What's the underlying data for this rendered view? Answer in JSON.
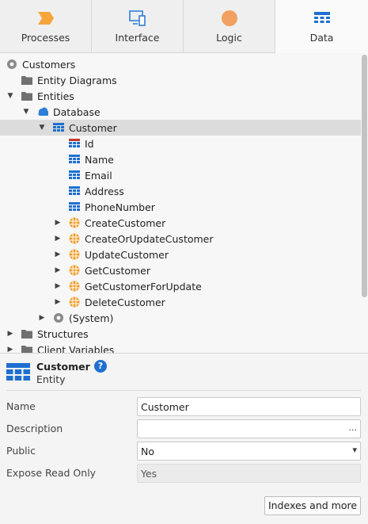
{
  "tabs": [
    {
      "label": "Processes",
      "icon": "processes-icon",
      "color": "#f5a53a"
    },
    {
      "label": "Interface",
      "icon": "interface-icon",
      "color": "#2f7fd9"
    },
    {
      "label": "Logic",
      "icon": "logic-icon",
      "color": "#f0a060"
    },
    {
      "label": "Data",
      "icon": "data-icon",
      "color": "#1e6fd1",
      "active": true
    }
  ],
  "tree": {
    "items": [
      {
        "label": "Customers",
        "icon": "module-icon",
        "arrow": "none"
      },
      {
        "label": "Entity Diagrams",
        "icon": "folder-icon",
        "arrow": "none"
      },
      {
        "label": "Entities",
        "icon": "folder-icon",
        "arrow": "expanded"
      },
      {
        "label": "Database",
        "icon": "database-icon",
        "arrow": "expanded"
      },
      {
        "label": "Customer",
        "icon": "entity-icon",
        "arrow": "expanded",
        "selected": true
      },
      {
        "label": "Id",
        "icon": "identifier-attribute-icon",
        "arrow": "none"
      },
      {
        "label": "Name",
        "icon": "attribute-icon",
        "arrow": "none"
      },
      {
        "label": "Email",
        "icon": "attribute-icon",
        "arrow": "none"
      },
      {
        "label": "Address",
        "icon": "attribute-icon",
        "arrow": "none"
      },
      {
        "label": "PhoneNumber",
        "icon": "attribute-icon",
        "arrow": "none"
      },
      {
        "label": "CreateCustomer",
        "icon": "entity-action-icon",
        "arrow": "collapsed"
      },
      {
        "label": "CreateOrUpdateCustomer",
        "icon": "entity-action-icon",
        "arrow": "collapsed"
      },
      {
        "label": "UpdateCustomer",
        "icon": "entity-action-icon",
        "arrow": "collapsed"
      },
      {
        "label": "GetCustomer",
        "icon": "entity-action-icon",
        "arrow": "collapsed"
      },
      {
        "label": "GetCustomerForUpdate",
        "icon": "entity-action-icon",
        "arrow": "collapsed"
      },
      {
        "label": "DeleteCustomer",
        "icon": "entity-action-icon",
        "arrow": "collapsed"
      },
      {
        "label": "(System)",
        "icon": "system-module-icon",
        "arrow": "collapsed"
      },
      {
        "label": "Structures",
        "icon": "folder-icon",
        "arrow": "collapsed"
      },
      {
        "label": "Client Variables",
        "icon": "folder-icon",
        "arrow": "collapsed"
      }
    ]
  },
  "props": {
    "title": "Customer",
    "subtitle": "Entity",
    "help": "?",
    "fields": [
      {
        "label": "Name",
        "value": "Customer"
      },
      {
        "label": "Description",
        "value": "",
        "trail": "..."
      },
      {
        "label": "Public",
        "value": "No",
        "trail": "▾"
      },
      {
        "label": "Expose Read Only",
        "value": "Yes"
      }
    ],
    "button": "Indexes and more"
  }
}
